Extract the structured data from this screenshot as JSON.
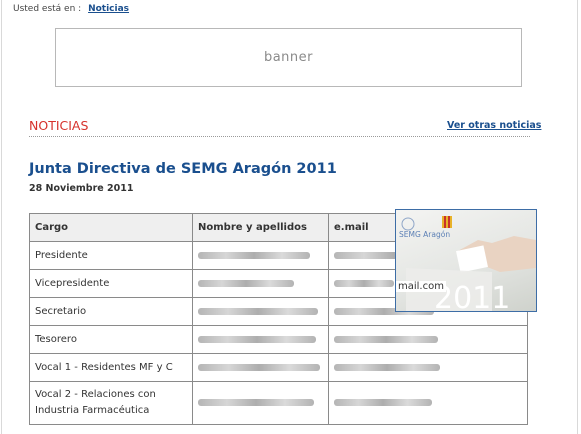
{
  "breadcrumb": {
    "prefix": "Usted está en :",
    "link": "Noticias"
  },
  "banner": {
    "label": "banner"
  },
  "section": {
    "title": "NOTICIAS",
    "more_link": "Ver otras noticias"
  },
  "article": {
    "title": "Junta Directiva de SEMG Aragón 2011",
    "date": "28 Noviembre 2011"
  },
  "table": {
    "headers": [
      "Cargo",
      "Nombre y apellidos",
      "e.mail"
    ],
    "rows": [
      {
        "cargo": "Presidente"
      },
      {
        "cargo": "Vicepresidente"
      },
      {
        "cargo": "Secretario"
      },
      {
        "cargo": "Tesorero"
      },
      {
        "cargo": "Vocal  1 - Residentes MF y C"
      },
      {
        "cargo_line1": "Vocal  2 - Relaciones con",
        "cargo_line2": "Industria Farmacéutica"
      }
    ]
  },
  "photo": {
    "logo_text": "SEMG Aragón",
    "year": "2011",
    "email_fragment": "mail.com"
  },
  "colors": {
    "accent_red": "#d6322c",
    "link_blue": "#1a4f8e"
  }
}
